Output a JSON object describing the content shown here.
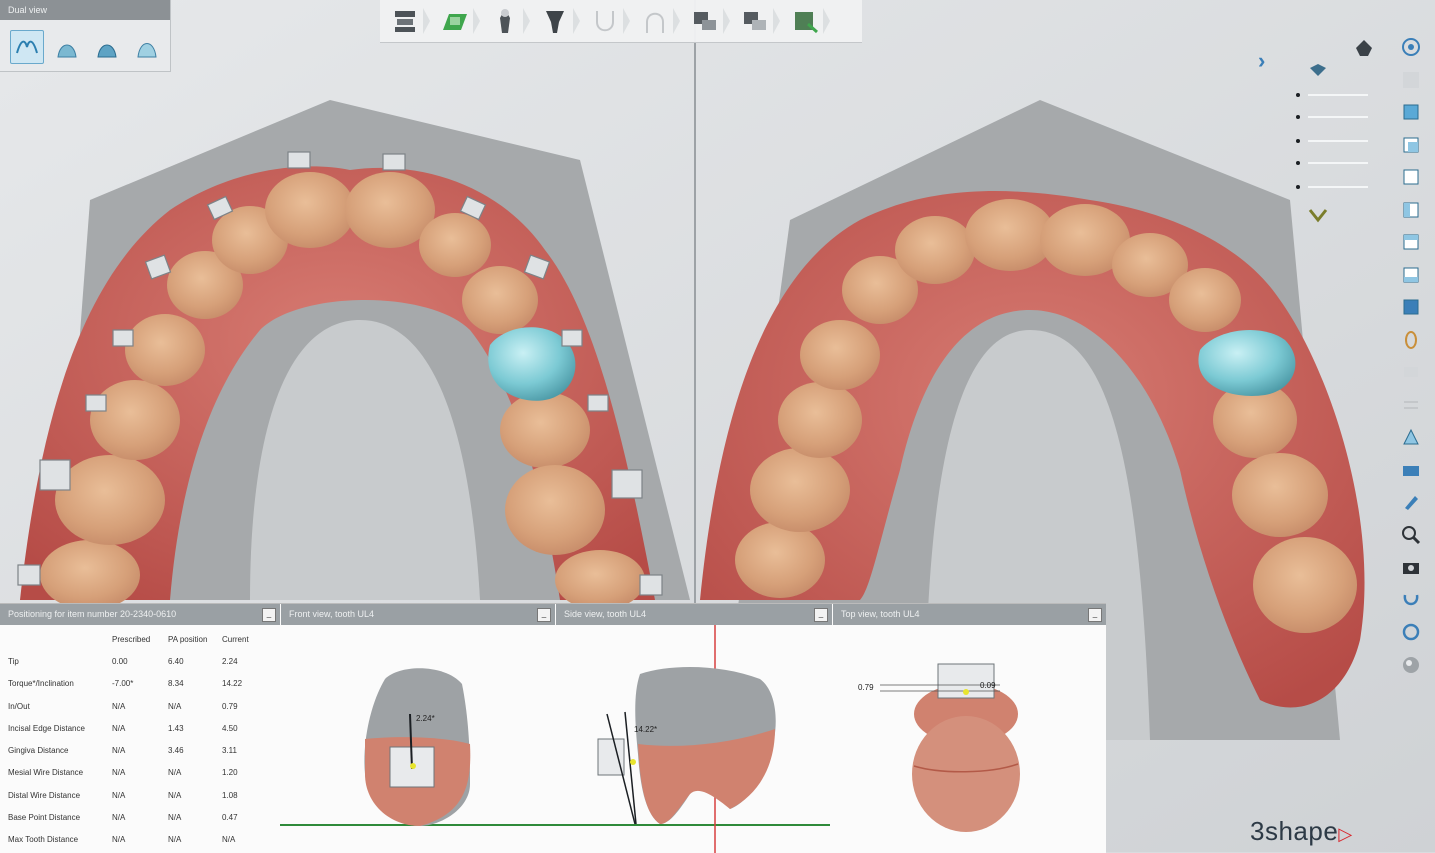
{
  "dual_view": {
    "title": "Dual view",
    "buttons": [
      {
        "icon": "bite-view-icon",
        "active": true
      },
      {
        "icon": "upper-jaw-icon",
        "active": false
      },
      {
        "icon": "lower-jaw-icon",
        "active": false
      },
      {
        "icon": "both-jaws-icon",
        "active": false
      }
    ]
  },
  "workflow_toolbar": [
    {
      "icon": "model-setup-icon"
    },
    {
      "icon": "scan-prep-icon"
    },
    {
      "icon": "tooth-segmentation-icon"
    },
    {
      "icon": "tooth-axis-icon"
    },
    {
      "icon": "upper-arch-icon"
    },
    {
      "icon": "lower-arch-icon"
    },
    {
      "icon": "bracket-placement-icon"
    },
    {
      "icon": "bracket-adjust-icon"
    },
    {
      "icon": "export-icon"
    }
  ],
  "positioning_panel": {
    "title": "Positioning for item number 20-2340-0610",
    "columns": [
      "Prescribed",
      "PA position",
      "Current"
    ],
    "rows": [
      {
        "label": "Tip",
        "prescribed": "0.00",
        "pa_position": "6.40",
        "current": "2.24"
      },
      {
        "label": "Torque*/Inclination",
        "prescribed": "-7.00*",
        "pa_position": "8.34",
        "current": "14.22"
      },
      {
        "label": "In/Out",
        "prescribed": "N/A",
        "pa_position": "N/A",
        "current": "0.79"
      },
      {
        "label": "Incisal Edge Distance",
        "prescribed": "N/A",
        "pa_position": "1.43",
        "current": "4.50"
      },
      {
        "label": "Gingiva Distance",
        "prescribed": "N/A",
        "pa_position": "3.46",
        "current": "3.11"
      },
      {
        "label": "Mesial Wire Distance",
        "prescribed": "N/A",
        "pa_position": "N/A",
        "current": "1.20"
      },
      {
        "label": "Distal Wire Distance",
        "prescribed": "N/A",
        "pa_position": "N/A",
        "current": "1.08"
      },
      {
        "label": "Base Point Distance",
        "prescribed": "N/A",
        "pa_position": "N/A",
        "current": "0.47"
      },
      {
        "label": "Max Tooth Distance",
        "prescribed": "N/A",
        "pa_position": "N/A",
        "current": "N/A"
      }
    ]
  },
  "front_view": {
    "title": "Front view, tooth UL4",
    "angle_label": "2.24*"
  },
  "side_view": {
    "title": "Side view, tooth UL4",
    "angle_label": "14.22*"
  },
  "top_view": {
    "title": "Top view, tooth UL4",
    "left_label": "0.79",
    "right_label": "0.09"
  },
  "brand": {
    "name": "3shape"
  },
  "colors": {
    "selection": "#6fc3cf",
    "gingiva": "#c4605a",
    "tooth": "#d9a47e",
    "accent": "#3b7fb8",
    "brand_red": "#d8262c"
  }
}
